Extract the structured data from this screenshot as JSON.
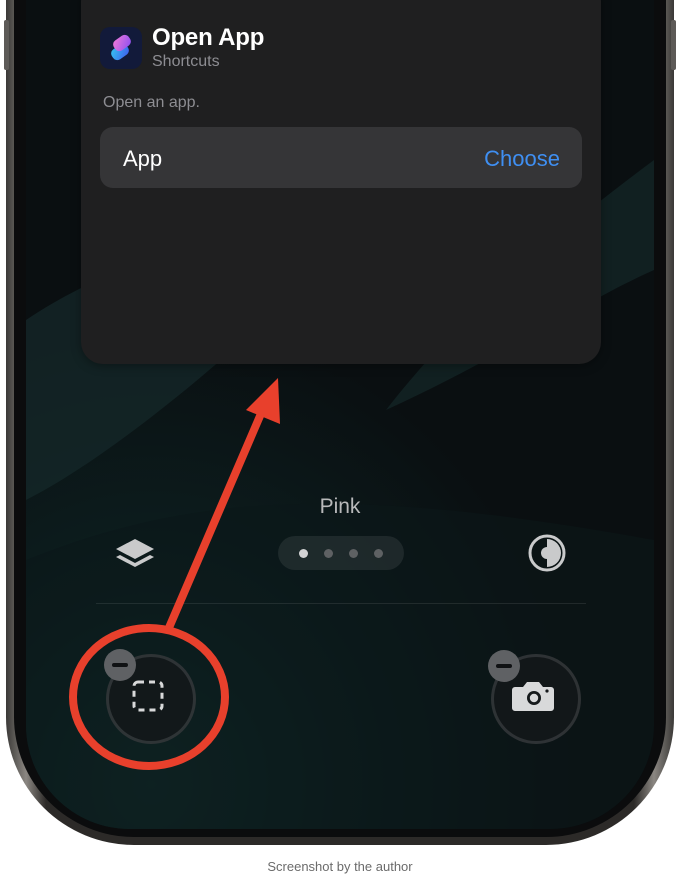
{
  "widget": {
    "title": "Open App",
    "app_name": "Shortcuts",
    "description": "Open an app.",
    "parameter": {
      "label": "App",
      "value": "Choose"
    }
  },
  "lock_screen": {
    "style_name": "Pink",
    "page_dots": {
      "count": 4,
      "active_index": 0
    },
    "left_icon": "layers-icon",
    "right_icon": "contrast-icon",
    "left_shortcut_icon": "dashed-square-icon",
    "right_shortcut_icon": "camera-icon"
  },
  "colors": {
    "accent_link": "#3f8ff2",
    "annotation_red": "#e8402c"
  },
  "caption": "Screenshot by the author"
}
